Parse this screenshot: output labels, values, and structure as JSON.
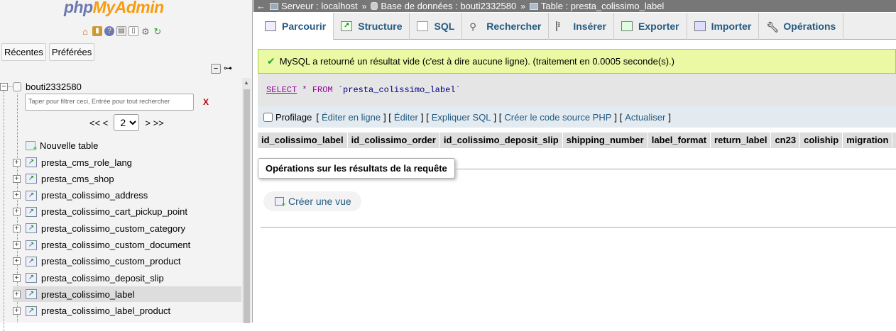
{
  "logo": {
    "php": "php",
    "myadmin": "MyAdmin"
  },
  "left_tabs": [
    "Récentes",
    "Préférées"
  ],
  "tree": {
    "database": "bouti2332580",
    "filter_placeholder": "Taper pour filtrer ceci, Entrée pour tout rechercher",
    "filter_clear": "X",
    "pager_prev": "<< <",
    "pager_page": "2",
    "pager_next": "> >>",
    "new_table": "Nouvelle table",
    "tables": [
      "presta_cms_role_lang",
      "presta_cms_shop",
      "presta_colissimo_address",
      "presta_colissimo_cart_pickup_point",
      "presta_colissimo_custom_category",
      "presta_colissimo_custom_document",
      "presta_colissimo_custom_product",
      "presta_colissimo_deposit_slip",
      "presta_colissimo_label",
      "presta_colissimo_label_product"
    ],
    "selected_table": "presta_colissimo_label"
  },
  "breadcrumb": {
    "server": "Serveur : localhost",
    "database": "Base de données : bouti2332580",
    "table": "Table : presta_colissimo_label",
    "separator": "»"
  },
  "main_tabs": [
    "Parcourir",
    "Structure",
    "SQL",
    "Rechercher",
    "Insérer",
    "Exporter",
    "Importer",
    "Opérations"
  ],
  "active_tab": "Parcourir",
  "success_message": "MySQL a retourné un résultat vide (c'est à dire aucune ligne). (traitement en 0.0005 seconde(s).)",
  "sql": {
    "select": "SELECT",
    "star": "*",
    "from": "FROM",
    "table": "`presta_colissimo_label`"
  },
  "profiling": {
    "label": "Profilage",
    "links": [
      "Éditer en ligne",
      "Éditer",
      "Expliquer SQL",
      "Créer le code source PHP",
      "Actualiser"
    ]
  },
  "columns": [
    "id_colissimo_label",
    "id_colissimo_order",
    "id_colissimo_deposit_slip",
    "shipping_number",
    "label_format",
    "return_label",
    "cn23",
    "coliship",
    "migration",
    "i"
  ],
  "operations": {
    "legend": "Opérations sur les résultats de la requête",
    "create_view": "Créer une vue"
  },
  "colors": {
    "topbar": "#777777",
    "success_bg": "#ebf8a4",
    "link": "#235a81",
    "logo_php": "#6c78af",
    "logo_myadmin": "#f89c0e"
  }
}
